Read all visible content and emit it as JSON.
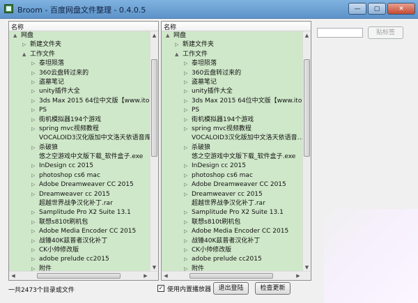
{
  "window": {
    "title": "Broom - 百度网盘文件整理 - 0.4.0.5",
    "buttons": [
      {
        "name": "minimize-button",
        "label": "—"
      },
      {
        "name": "maximize-button",
        "label": "▢"
      },
      {
        "name": "close-button",
        "label": "✕"
      }
    ]
  },
  "left_pane": {
    "header": "名称",
    "rows": [
      {
        "text": "网盘",
        "level": 0,
        "arrow": "▲"
      },
      {
        "text": "新建文件夹",
        "level": 1,
        "arrow": "▷"
      },
      {
        "text": "工作文件",
        "level": 1,
        "arrow": "▲"
      },
      {
        "text": "泰坦陨落",
        "level": 2,
        "arrow": "▷"
      },
      {
        "text": "360云盘转过来的",
        "level": 2,
        "arrow": "▷"
      },
      {
        "text": "盗墓笔记",
        "level": 2,
        "arrow": "▷"
      },
      {
        "text": "unity插件大全",
        "level": 2,
        "arrow": "▷"
      },
      {
        "text": "3ds Max 2015 64位中文版【www.itopdo",
        "level": 2,
        "arrow": "▷"
      },
      {
        "text": "PS",
        "level": 2,
        "arrow": "▷"
      },
      {
        "text": "街机模拟器194个游戏",
        "level": 2,
        "arrow": "▷"
      },
      {
        "text": "spring mvc视频教程",
        "level": 2,
        "arrow": "▷"
      },
      {
        "text": "VOCALOID3汉化版加中文洛天依语音库附",
        "level": 2,
        "arrow": ""
      },
      {
        "text": "杀破狼",
        "level": 2,
        "arrow": "▷"
      },
      {
        "text": "悠之空游戏中文版下载_软件盒子.exe",
        "level": 2,
        "arrow": ""
      },
      {
        "text": "InDesign cc 2015",
        "level": 2,
        "arrow": "▷"
      },
      {
        "text": "photoshop cs6 mac",
        "level": 2,
        "arrow": "▷"
      },
      {
        "text": "Adobe Dreamweaver CC 2015",
        "level": 2,
        "arrow": "▷"
      },
      {
        "text": "Dreamweaver cc 2015",
        "level": 2,
        "arrow": "▷"
      },
      {
        "text": "超越世界战争汉化补丁.rar",
        "level": 2,
        "arrow": ""
      },
      {
        "text": "Samplitude Pro X2 Suite 13.1",
        "level": 2,
        "arrow": "▷"
      },
      {
        "text": "联想s810t刷机包",
        "level": 2,
        "arrow": "▷"
      },
      {
        "text": "Adobe Media Encoder CC 2015",
        "level": 2,
        "arrow": "▷"
      },
      {
        "text": "战锤40K兹普者汉化补丁",
        "level": 2,
        "arrow": "▷"
      },
      {
        "text": "CK小帅修改版",
        "level": 2,
        "arrow": "▷"
      },
      {
        "text": "adobe prelude cc2015",
        "level": 2,
        "arrow": "▷"
      },
      {
        "text": "附件",
        "level": 2,
        "arrow": "▷"
      }
    ]
  },
  "right_pane": {
    "header": "名称",
    "rows": [
      {
        "text": "网盘",
        "level": 0,
        "arrow": "▲"
      },
      {
        "text": "新建文件夹",
        "level": 1,
        "arrow": "▷"
      },
      {
        "text": "工作文件",
        "level": 1,
        "arrow": "▲"
      },
      {
        "text": "泰坦陨落",
        "level": 2,
        "arrow": "▷"
      },
      {
        "text": "360云盘转过来的",
        "level": 2,
        "arrow": "▷"
      },
      {
        "text": "盗墓笔记",
        "level": 2,
        "arrow": "▷"
      },
      {
        "text": "unity插件大全",
        "level": 2,
        "arrow": "▷"
      },
      {
        "text": "3ds Max 2015 64位中文版【www.ito…",
        "level": 2,
        "arrow": "▷"
      },
      {
        "text": "PS",
        "level": 2,
        "arrow": "▷"
      },
      {
        "text": "街机模拟器194个游戏",
        "level": 2,
        "arrow": "▷"
      },
      {
        "text": "spring mvc视频教程",
        "level": 2,
        "arrow": "▷"
      },
      {
        "text": "VOCALOID3汉化版加中文洛天依语音…",
        "level": 2,
        "arrow": ""
      },
      {
        "text": "杀破狼",
        "level": 2,
        "arrow": "▷"
      },
      {
        "text": "悠之空游戏中文版下载_软件盒子.exe",
        "level": 2,
        "arrow": ""
      },
      {
        "text": "InDesign cc 2015",
        "level": 2,
        "arrow": "▷"
      },
      {
        "text": "photoshop cs6 mac",
        "level": 2,
        "arrow": "▷"
      },
      {
        "text": "Adobe Dreamweaver CC 2015",
        "level": 2,
        "arrow": "▷"
      },
      {
        "text": "Dreamweaver cc 2015",
        "level": 2,
        "arrow": "▷"
      },
      {
        "text": "超越世界战争汉化补丁.rar",
        "level": 2,
        "arrow": ""
      },
      {
        "text": "Samplitude Pro X2 Suite 13.1",
        "level": 2,
        "arrow": "▷"
      },
      {
        "text": "联想s810t刷机包",
        "level": 2,
        "arrow": "▷"
      },
      {
        "text": "Adobe Media Encoder CC 2015",
        "level": 2,
        "arrow": "▷"
      },
      {
        "text": "战锤40K兹普者汉化补丁",
        "level": 2,
        "arrow": "▷"
      },
      {
        "text": "CK小帅修改版",
        "level": 2,
        "arrow": "▷"
      },
      {
        "text": "adobe prelude cc2015",
        "level": 2,
        "arrow": "▷"
      },
      {
        "text": "附件",
        "level": 2,
        "arrow": "▷"
      }
    ]
  },
  "tag": {
    "input_value": "",
    "button_label": "贴标签"
  },
  "footer": {
    "status": "一共2473个目录或文件",
    "checkbox_label": "使用内置播放器",
    "checkbox_checked": true,
    "checkbox_mark": "✓",
    "logout_label": "退出登陆",
    "update_label": "检查更新"
  },
  "scroll_glyphs": {
    "up": "▲",
    "down": "▼",
    "left": "◀",
    "right": "▶"
  }
}
